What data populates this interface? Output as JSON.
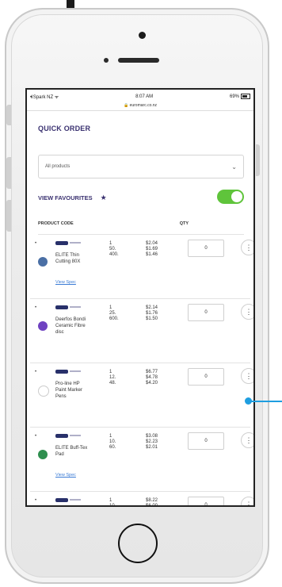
{
  "status": {
    "carrier": "Spark NZ",
    "time": "8:07 AM",
    "battery": "69%"
  },
  "url": "euromarc.co.nz",
  "page": {
    "title": "QUICK ORDER"
  },
  "filter": {
    "selected": "All products"
  },
  "favourites": {
    "label": "VIEW FAVOURITES",
    "toggle_on": true
  },
  "columns": {
    "product": "PRODUCT CODE",
    "qty": "QTY"
  },
  "products": [
    {
      "name": "ELITE Thin Cutting 80X",
      "qtys": "1\n50.\n400.",
      "prices": "$2.04\n$1.69\n$1.46",
      "qty": "0",
      "spec": "View Spec",
      "color": "#4a6fa5"
    },
    {
      "name": "Deerfos Bondi Ceramic Fibre disc",
      "qtys": "1\n25.\n600.",
      "prices": "$2.14\n$1.76\n$1.50",
      "qty": "0",
      "spec": "",
      "color": "#6f42c1"
    },
    {
      "name": "Pro-line HP Paint Marker Pens",
      "qtys": "1\n12.\n48.",
      "prices": "$6.77\n$4.78\n$4.20",
      "qty": "0",
      "spec": "",
      "color": "#ffffff"
    },
    {
      "name": "ELITE Buff-Tex Pad",
      "qtys": "1\n10.\n60.",
      "prices": "$3.08\n$2.23\n$2.01",
      "qty": "0",
      "spec": "View Spec",
      "color": "#2f8f4f"
    },
    {
      "name": "",
      "qtys": "1\n10",
      "prices": "$8.22\n$6.00",
      "qty": "0",
      "spec": "",
      "color": "#ffffff"
    }
  ],
  "more_label": "⋮"
}
